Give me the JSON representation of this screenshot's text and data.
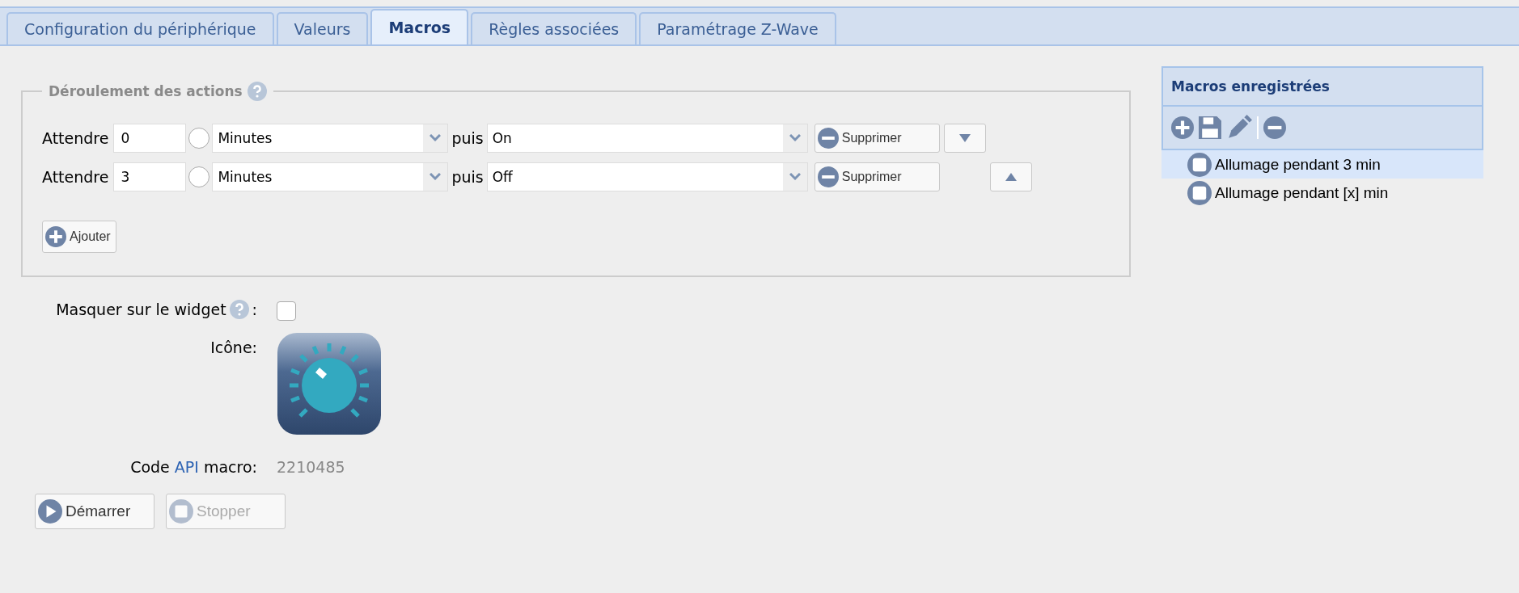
{
  "tabs": [
    {
      "label": "Configuration du périphérique",
      "selected": false
    },
    {
      "label": "Valeurs",
      "selected": false
    },
    {
      "label": "Macros",
      "selected": true
    },
    {
      "label": "Règles associées",
      "selected": false
    },
    {
      "label": "Paramétrage Z-Wave",
      "selected": false
    }
  ],
  "actions": {
    "legend": "Déroulement des actions",
    "rows": [
      {
        "label": "Attendre",
        "delay": "0",
        "radio_selected": false,
        "unit": "Minutes",
        "connector": "puis",
        "action": "On",
        "delete_label": "Supprimer",
        "kind": "down"
      },
      {
        "label": "Attendre",
        "delay": "3",
        "radio_selected": false,
        "unit": "Minutes",
        "connector": "puis",
        "action": "Off",
        "delete_label": "Supprimer",
        "kind": "up"
      }
    ],
    "add_label": "Ajouter"
  },
  "macros_panel": {
    "title": "Macros enregistrées",
    "items": [
      {
        "label": "Allumage pendant 3 min",
        "selected": true
      },
      {
        "label": "Allumage pendant [x] min",
        "selected": false
      }
    ]
  },
  "hide_on_widget": {
    "label": "Masquer sur le widget",
    "suffix": ":",
    "checked": false
  },
  "icon_label": "Icône:",
  "api_code": {
    "prefix": "Code",
    "link": "API",
    "suffix": "macro:",
    "value": "2210485"
  },
  "buttons": [
    {
      "label": "Démarrer",
      "kind": "start",
      "disabled": false
    },
    {
      "label": "Stopper",
      "kind": "stop",
      "disabled": true
    }
  ]
}
